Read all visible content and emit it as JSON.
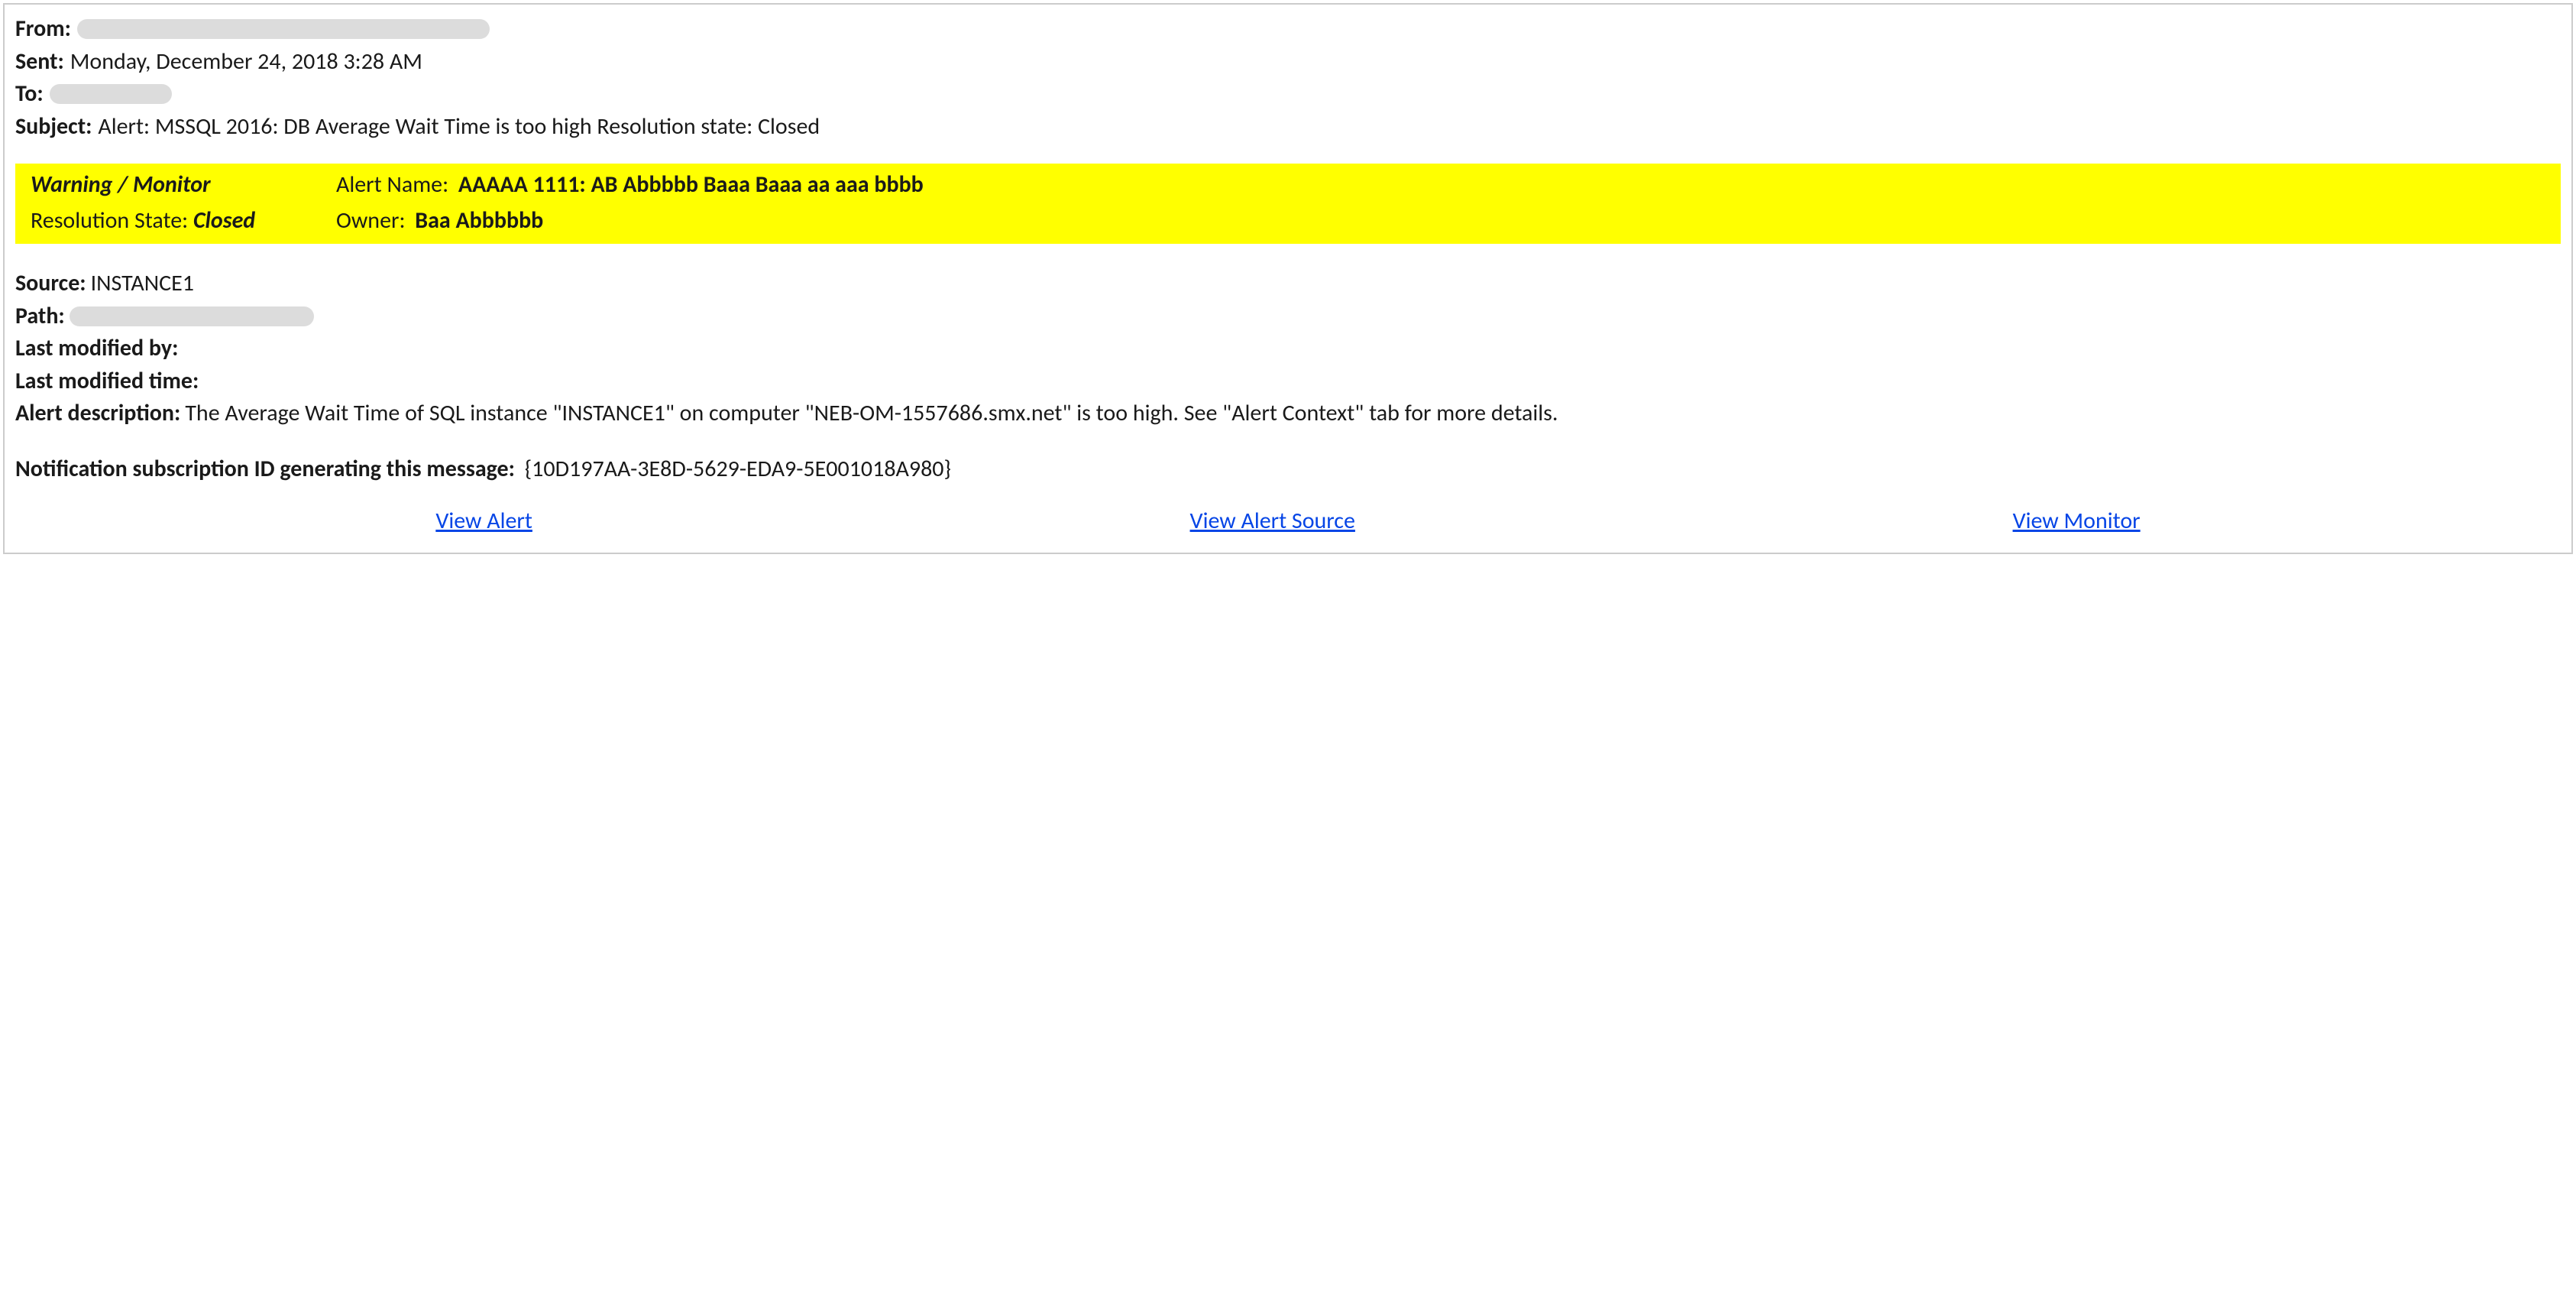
{
  "header": {
    "from_label": "From:",
    "from_value": "",
    "sent_label": "Sent:",
    "sent_value": "Monday, December 24, 2018 3:28 AM",
    "to_label": "To:",
    "to_value": "",
    "subject_label": "Subject:",
    "subject_value": "Alert: MSSQL 2016: DB Average Wait Time is too high Resolution state: Closed"
  },
  "banner": {
    "warning_label": "Warning / Monitor",
    "alert_name_label": "Alert Name:",
    "alert_name_value": "AAAAA 1111: AB Abbbbb Baaa Baaa aa aaa bbbb",
    "resolution_label": "Resolution State: ",
    "resolution_value": "Closed",
    "owner_label": "Owner:",
    "owner_value": "Baa Abbbbbb"
  },
  "body": {
    "source_label": "Source:",
    "source_value": "INSTANCE1",
    "path_label": "Path:",
    "path_value": "",
    "last_modified_by_label": "Last modified by:",
    "last_modified_by_value": "",
    "last_modified_time_label": "Last modified time:",
    "last_modified_time_value": "",
    "alert_desc_label": "Alert description:",
    "alert_desc_value": "The Average Wait Time of SQL instance \"INSTANCE1\" on computer \"NEB-OM-1557686.smx.net\" is too high. See \"Alert Context\" tab for more details.",
    "notif_label": "Notification subscription ID generating this message:",
    "notif_value": "{10D197AA-3E8D-5629-EDA9-5E001018A980}"
  },
  "links": {
    "view_alert": "View Alert",
    "view_alert_source": "View Alert Source",
    "view_monitor": "View Monitor"
  }
}
